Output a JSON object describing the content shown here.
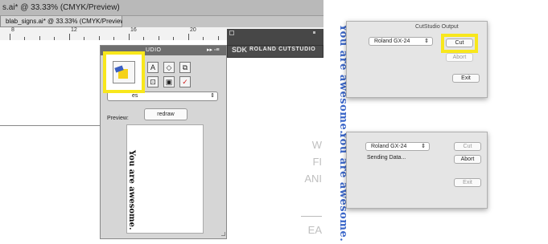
{
  "left": {
    "window_title": "s.ai* @ 33.33% (CMYK/Preview)",
    "document_tab": "blab_signs.ai* @ 33.33% (CMYK/Preview)",
    "ruler_numbers": [
      "8",
      "12",
      "16",
      "20"
    ],
    "panel": {
      "title": "UDIO",
      "menu_glyph": "▸▸ ▫≡",
      "select_value": "es",
      "preview_label": "Preview:",
      "redraw_label": "redraw",
      "preview_text": "You are awesome."
    },
    "sdk_panel": {
      "logo": "SDK",
      "title": "ROLAND CUTSTUDIO"
    },
    "art_letters": [
      "W",
      "FI",
      "ANI",
      "EA"
    ]
  },
  "right": {
    "dialog1": {
      "title": "CutStudio Output",
      "device": "Roland GX-24",
      "cut_label": "Cut",
      "abort_label": "Abort",
      "exit_label": "Exit"
    },
    "dialog2": {
      "device": "Roland GX-24",
      "status": "Sending Data...",
      "cut_label": "Cut",
      "abort_label": "Abort",
      "exit_label": "Exit"
    },
    "vertical_text_top": "You are awesome.",
    "vertical_text_bottom": "You are awesome."
  },
  "colors": {
    "highlight": "#f8e71c",
    "vertical_text": "#3a66c9"
  }
}
